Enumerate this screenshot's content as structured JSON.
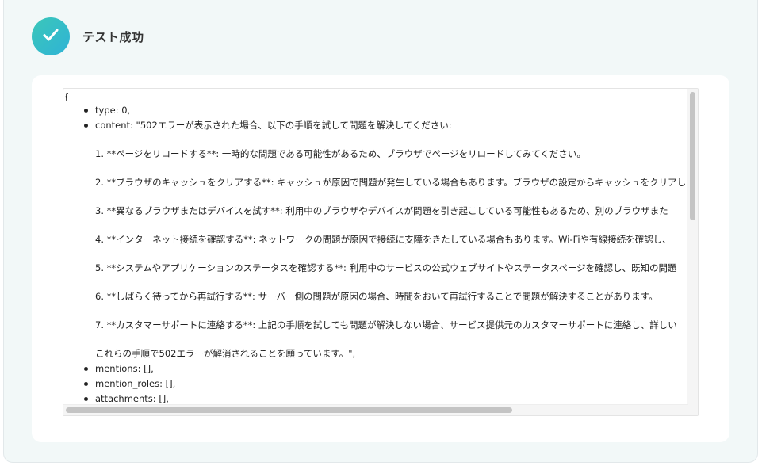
{
  "header": {
    "title": "テスト成功",
    "icon": "check-icon",
    "icon_colors": [
      "#3bc7b9",
      "#2fb3d6"
    ]
  },
  "output": {
    "open_brace": "{",
    "type_line": "type: 0,",
    "content_first": "content: \"502エラーが表示された場合、以下の手順を試して問題を解決してください:",
    "steps": [
      "1. **ページをリロードする**: 一時的な問題である可能性があるため、ブラウザでページをリロードしてみてください。",
      "2. **ブラウザのキャッシュをクリアする**: キャッシュが原因で問題が発生している場合もあります。ブラウザの設定からキャッシュをクリアし",
      "3. **異なるブラウザまたはデバイスを試す**: 利用中のブラウザやデバイスが問題を引き起こしている可能性もあるため、別のブラウザまた",
      "4. **インターネット接続を確認する**: ネットワークの問題が原因で接続に支障をきたしている場合もあります。Wi-Fiや有線接続を確認し、",
      "5. **システムやアプリケーションのステータスを確認する**: 利用中のサービスの公式ウェブサイトやステータスページを確認し、既知の問題",
      "6. **しばらく待ってから再試行する**: サーバー側の問題が原因の場合、時間をおいて再試行することで問題が解決することがあります。",
      "7. **カスタマーサポートに連絡する**: 上記の手順を試しても問題が解決しない場合、サービス提供元のカスタマーサポートに連絡し、詳しい"
    ],
    "closing": "これらの手順で502エラーが解消されることを願っています。\",",
    "mentions_line": "mentions: [],",
    "mention_roles_line": "mention_roles: [],",
    "attachments_line": "attachments: [],"
  }
}
